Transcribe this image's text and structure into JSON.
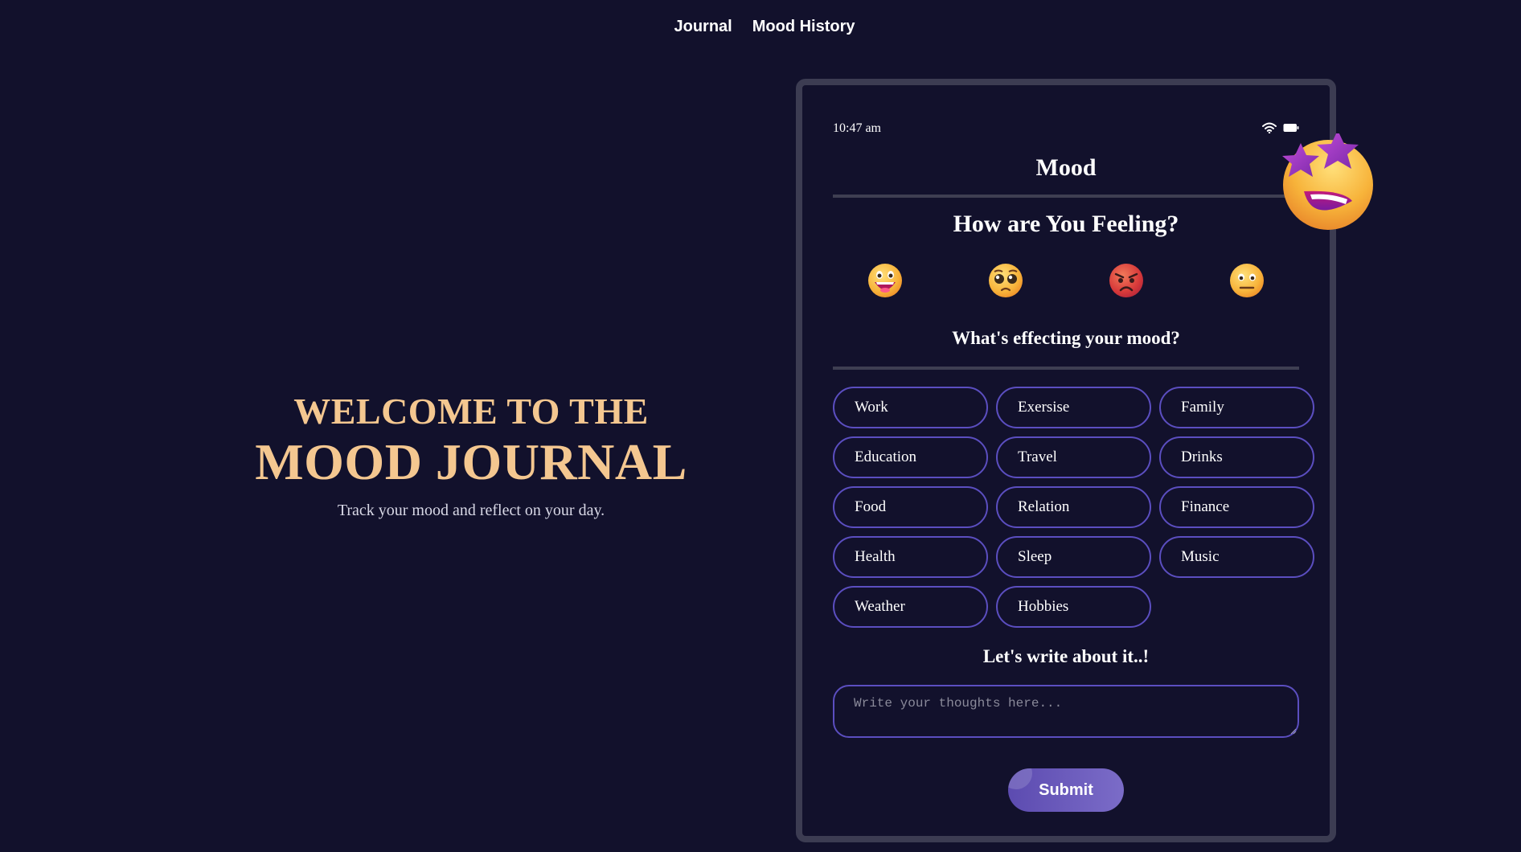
{
  "nav": {
    "journal": "Journal",
    "mood_history": "Mood History"
  },
  "hero": {
    "line1": "WELCOME TO THE",
    "line2": "MOOD JOURNAL",
    "subtitle": "Track your mood and reflect on your day."
  },
  "phone": {
    "time": "10:47 am",
    "status_icons": [
      "wifi-icon",
      "battery-icon"
    ],
    "title": "Mood",
    "question": "How are You Feeling?",
    "moods": [
      "happy-emoji",
      "pleading-emoji",
      "angry-emoji",
      "neutral-emoji"
    ],
    "effect_title": "What's effecting your mood?",
    "tags": [
      "Work",
      "Exersise",
      "Family",
      "Education",
      "Travel",
      "Drinks",
      "Food",
      "Relation",
      "Finance",
      "Health",
      "Sleep",
      "Music",
      "Weather",
      "Hobbies"
    ],
    "write_title": "Let's write about it..!",
    "thoughts_placeholder": "Write your thoughts here...",
    "thoughts_value": "",
    "submit_label": "Submit",
    "decoration": "star-struck-emoji"
  },
  "colors": {
    "background": "#12112c",
    "accent_gold": "#f4c790",
    "tag_border": "#5b4ec0",
    "submit_start": "#5c4bb0",
    "submit_end": "#7b6cc8",
    "frame": "#3c3c52"
  }
}
